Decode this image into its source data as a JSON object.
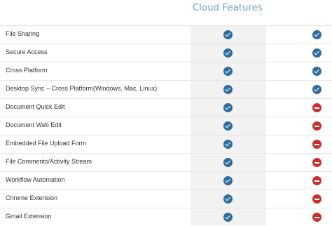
{
  "header": {
    "title": "Cloud Features"
  },
  "rows": [
    {
      "label": "File Sharing",
      "col_a": "check-icon",
      "col_b": "check-icon"
    },
    {
      "label": "Secure Access",
      "col_a": "check-icon",
      "col_b": "check-icon"
    },
    {
      "label": "Cross Platform",
      "col_a": "check-icon",
      "col_b": "check-icon"
    },
    {
      "label": "Desktop Sync – Cross Platform(Windows, Mac, Linux)",
      "col_a": "check-icon",
      "col_b": "check-icon"
    },
    {
      "label": "Document Quick Edit",
      "col_a": "check-icon",
      "col_b": "no-icon"
    },
    {
      "label": "Document Web Edit",
      "col_a": "check-icon",
      "col_b": "no-icon"
    },
    {
      "label": "Embedded File Upload Form",
      "col_a": "check-icon",
      "col_b": "no-icon"
    },
    {
      "label": "File Comments/Activity Stream",
      "col_a": "check-icon",
      "col_b": "no-icon"
    },
    {
      "label": "Workflow Automation",
      "col_a": "check-icon",
      "col_b": "no-icon"
    },
    {
      "label": "Chrome Extension",
      "col_a": "check-icon",
      "col_b": "no-icon"
    },
    {
      "label": "Gmail Extension",
      "col_a": "check-icon",
      "col_b": "no-icon"
    }
  ],
  "colors": {
    "check": "#2d6e9e",
    "no": "#c9302c",
    "header_text": "#6aa3c6"
  }
}
